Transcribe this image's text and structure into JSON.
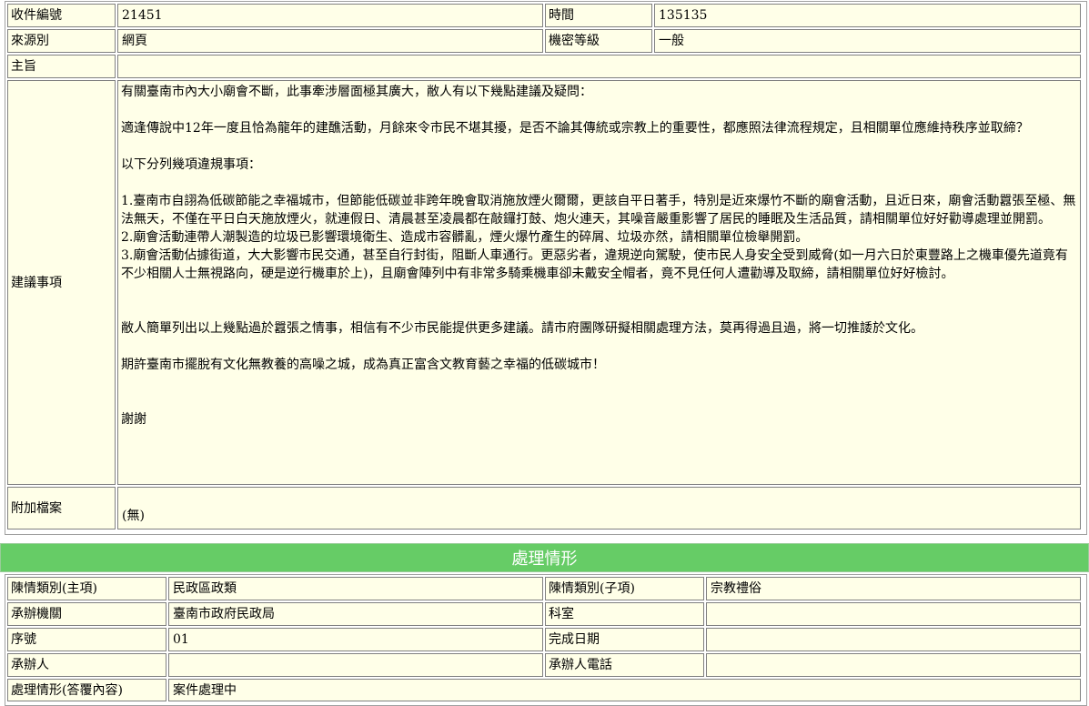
{
  "case": {
    "receipt_no_label": "收件編號",
    "receipt_no": "21451",
    "time_label": "時間",
    "time": "135135",
    "source_label": "來源別",
    "source": "網頁",
    "secrecy_label": "機密等級",
    "secrecy": "一般",
    "subject_label": "主旨",
    "subject": "",
    "suggestion_label": "建議事項",
    "suggestion_paragraphs": [
      " 有關臺南市內大小廟會不斷，此事牽涉層面極其廣大，敝人有以下幾點建議及疑問：",
      "適逢傳說中12年一度且恰為龍年的建醮活動，月餘來令市民不堪其擾，是否不論其傳統或宗教上的重要性，都應照法律流程規定，且相關單位應維持秩序並取締？",
      "以下分列幾項違規事項：",
      "1.臺南市自詡為低碳節能之幸福城市，但節能低碳並非跨年晚會取消施放煙火爾爾，更該自平日著手，特別是近來爆竹不斷的廟會活動，且近日來，廟會活動囂張至極、無法無天，不僅在平日白天施放煙火，就連假日、清晨甚至凌晨都在敲鑼打鼓、炮火連天，其噪音嚴重影響了居民的睡眠及生活品質，請相關單位好好勸導處理並開罰。",
      "2.廟會活動連帶人潮製造的垃圾已影響環境衛生、造成市容髒亂，煙火爆竹產生的碎屑、垃圾亦然，請相關單位檢舉開罰。",
      "3.廟會活動佔據街道，大大影響市民交通，甚至自行封街，阻斷人車通行。更惡劣者，違規逆向駕駛，使市民人身安全受到威脅(如一月六日於東豐路上之機車優先道竟有不少相關人士無視路向，硬是逆行機車於上)，且廟會陣列中有非常多騎乘機車卻未戴安全帽者，竟不見任何人遭勸導及取締，請相關單位好好檢討。",
      "敝人簡單列出以上幾點過於囂張之情事，相信有不少市民能提供更多建議。請市府團隊研擬相關處理方法，莫再得過且過，將一切推諉於文化。",
      "期許臺南市擺脫有文化無教養的高噪之城，成為真正富含文教育藝之幸福的低碳城市！",
      "謝謝"
    ],
    "attachment_label": "附加檔案",
    "attachment": "(無)"
  },
  "processing": {
    "title": "處理情形",
    "category_main_label": "陳情類別(主項)",
    "category_main": "民政區政類",
    "category_sub_label": "陳情類別(子項)",
    "category_sub": "宗教禮俗",
    "agency_label": "承辦機關",
    "agency": "臺南市政府民政局",
    "section_label": "科室",
    "section": "",
    "seq_label": "序號",
    "seq": "01",
    "done_date_label": "完成日期",
    "done_date": "",
    "handler_label": "承辦人",
    "handler": "",
    "handler_phone_label": "承辦人電話",
    "handler_phone": "",
    "reply_label": "處理情形(答覆內容)",
    "reply": "案件處理中"
  },
  "colors": {
    "cell_bg": "#ffffe8",
    "banner_bg": "#66cc66",
    "banner_text": "#ffffff"
  }
}
